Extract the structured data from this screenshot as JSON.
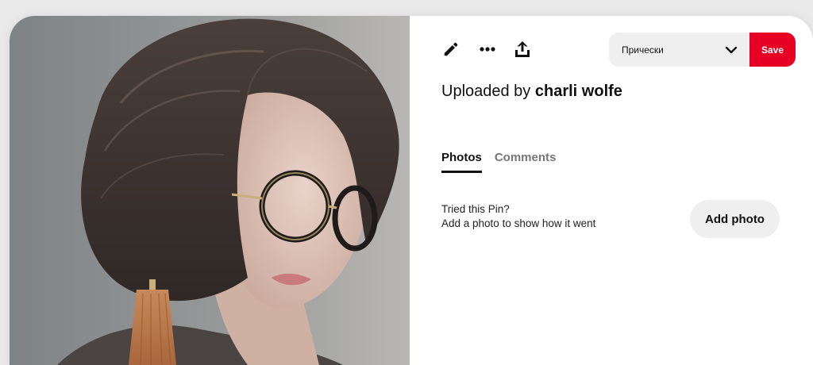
{
  "pin": {
    "image_alt": "Woman with short bob haircut wearing round glasses"
  },
  "toolbar": {
    "edit_icon": "pencil-icon",
    "more_icon": "ellipsis-icon",
    "share_icon": "share-upload-icon"
  },
  "board": {
    "selected": "Прически",
    "chevron_icon": "chevron-down-icon"
  },
  "save_label": "Save",
  "uploaded": {
    "prefix": "Uploaded by ",
    "name": "charli wolfe"
  },
  "tabs": [
    {
      "label": "Photos",
      "active": true
    },
    {
      "label": "Comments",
      "active": false
    }
  ],
  "tried": {
    "title": "Tried this Pin?",
    "subtitle": "Add a photo to show how it went"
  },
  "add_photo_label": "Add photo",
  "colors": {
    "accent": "#e60023",
    "pill_bg": "#efefef",
    "text": "#111111",
    "muted": "#767676"
  }
}
